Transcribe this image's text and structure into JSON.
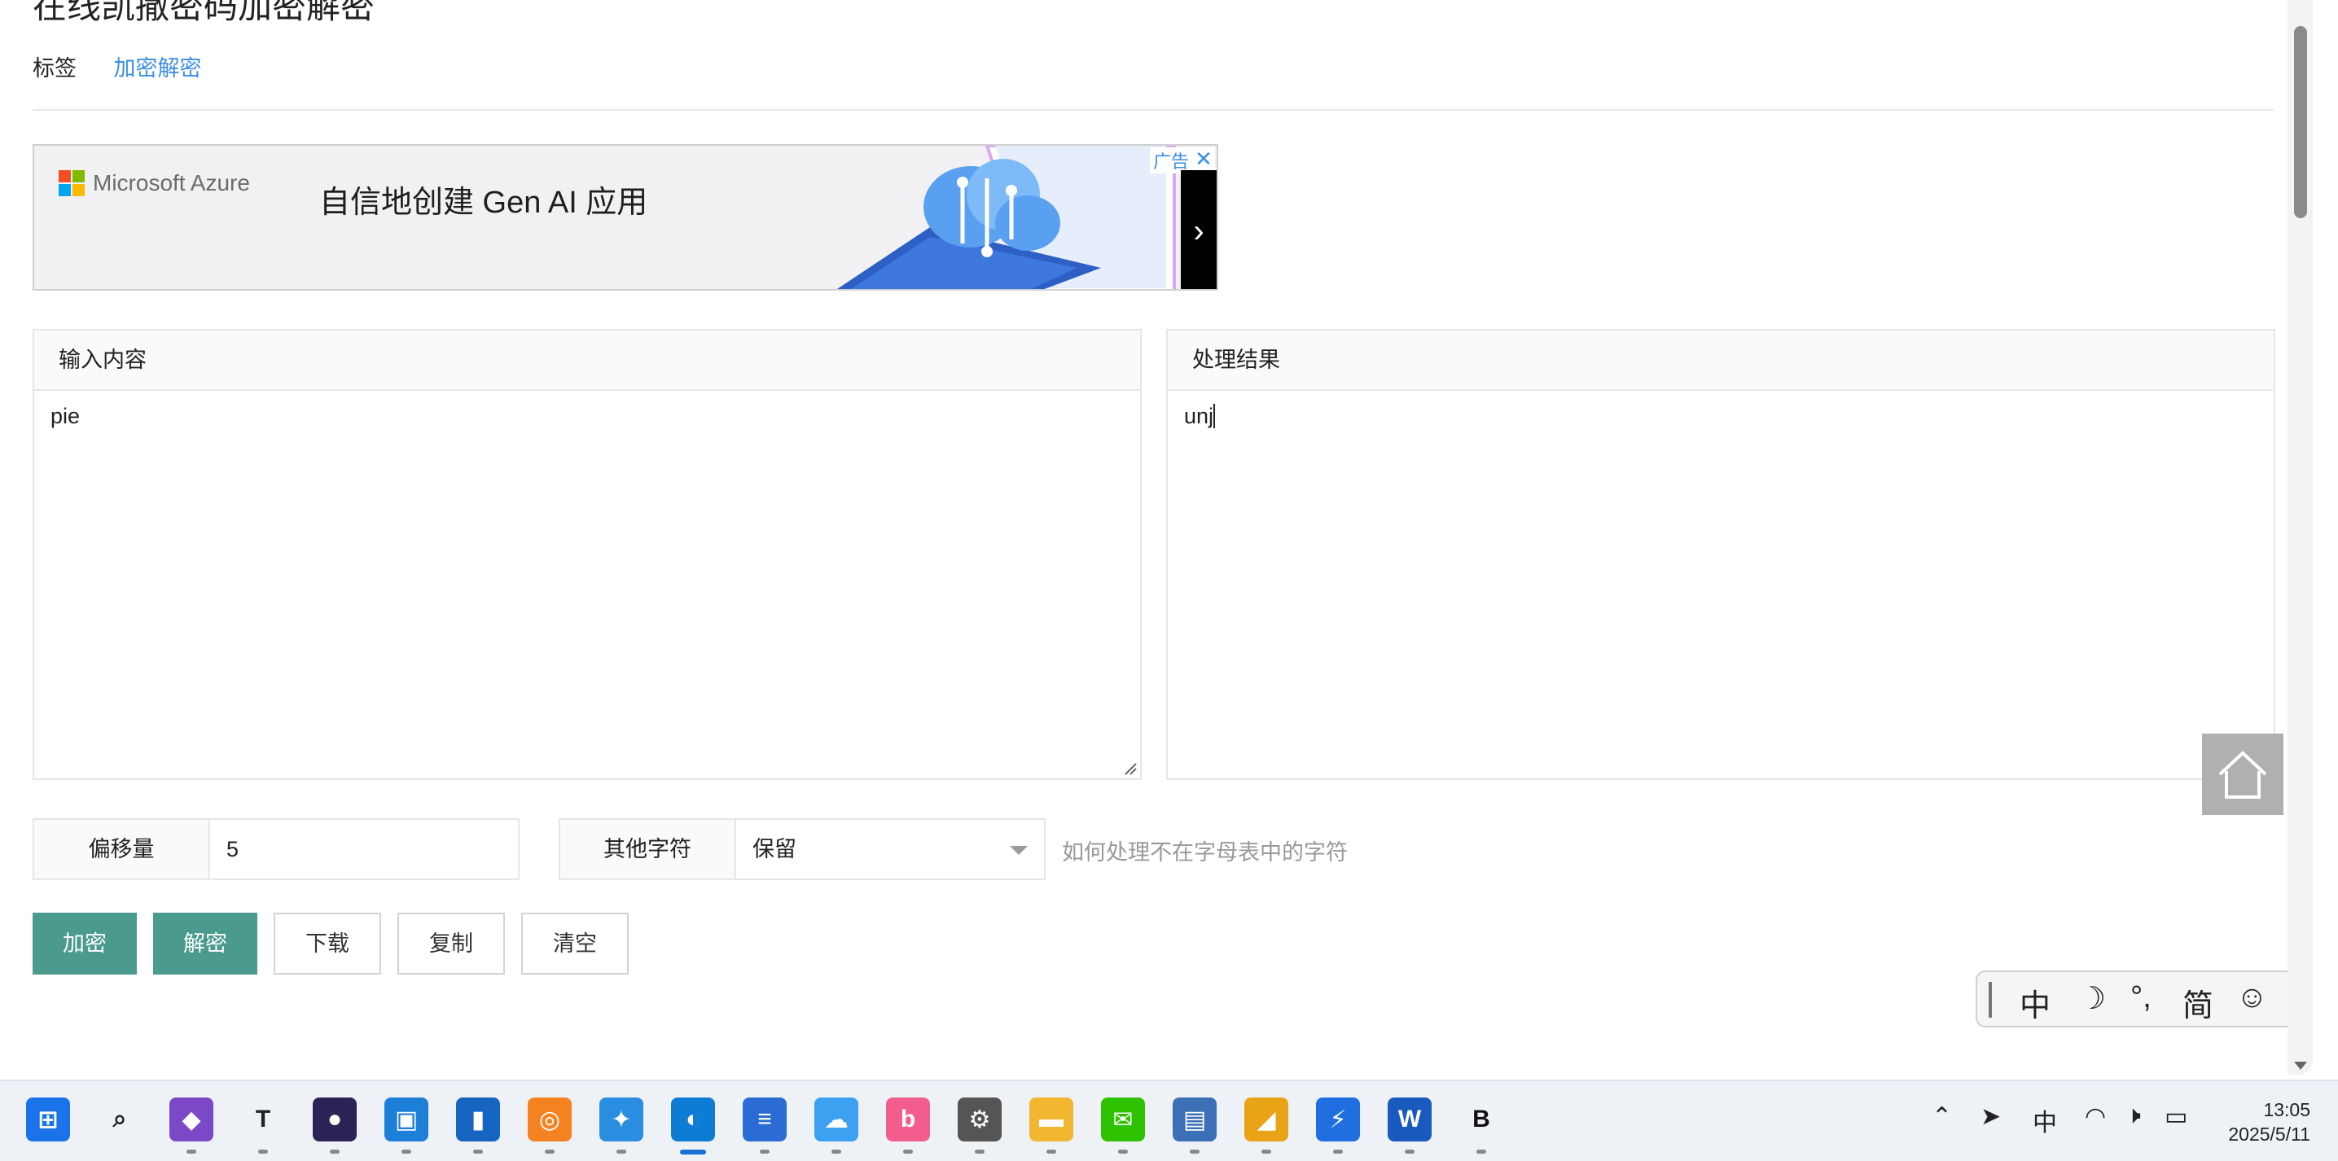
{
  "page": {
    "title": "在线凯撒密码加密解密",
    "tag_label": "标签",
    "tag_link": "加密解密"
  },
  "ad": {
    "brand": "Microsoft Azure",
    "headline": "自信地创建 Gen AI 应用",
    "label": "广告",
    "close": "✕",
    "next": "›",
    "colors": {
      "ms_red": "#f25022",
      "ms_green": "#7fba00",
      "ms_blue": "#00a4ef",
      "ms_yellow": "#ffb900"
    }
  },
  "input_panel": {
    "header": "输入内容",
    "value": "pie"
  },
  "output_panel": {
    "header": "处理结果",
    "value": "unj"
  },
  "controls": {
    "offset_label": "偏移量",
    "offset_value": "5",
    "other_label": "其他字符",
    "other_value": "保留",
    "hint": "如何处理不在字母表中的字符"
  },
  "buttons": {
    "encrypt": "加密",
    "decrypt": "解密",
    "download": "下载",
    "copy": "复制",
    "clear": "清空"
  },
  "ime_toolbar": {
    "lang": "中",
    "moon": "☽",
    "punct": "°,",
    "simplified": "简",
    "emoji": "☺",
    "settings": "⚙"
  },
  "taskbar": {
    "apps": [
      {
        "name": "start-icon",
        "glyph": "⊞",
        "color": "#1a73e8"
      },
      {
        "name": "search-icon",
        "glyph": "⌕",
        "color": "#222222"
      },
      {
        "name": "visual-studio-icon",
        "glyph": "◆",
        "color": "#7b49c8"
      },
      {
        "name": "typora-icon",
        "glyph": "T",
        "color": "#222222"
      },
      {
        "name": "eclipse-icon",
        "glyph": "●",
        "color": "#2c2255"
      },
      {
        "name": "virtualbox-icon",
        "glyph": "▣",
        "color": "#1e7fd8"
      },
      {
        "name": "winrar-icon",
        "glyph": "▮",
        "color": "#1565c0"
      },
      {
        "name": "everything-search-icon",
        "glyph": "◎",
        "color": "#f58220"
      },
      {
        "name": "chat-app-icon",
        "glyph": "✦",
        "color": "#2a8de0"
      },
      {
        "name": "edge-browser-icon",
        "glyph": "◐",
        "color": "#0c7cd5"
      },
      {
        "name": "notepad-icon",
        "glyph": "≡",
        "color": "#2b6cd4"
      },
      {
        "name": "baidu-netdisk-icon",
        "glyph": "☁",
        "color": "#3da0f0"
      },
      {
        "name": "bilibili-icon",
        "glyph": "b",
        "color": "#f25d8e"
      },
      {
        "name": "settings-icon",
        "glyph": "⚙",
        "color": "#555555"
      },
      {
        "name": "file-explorer-icon",
        "glyph": "▬",
        "color": "#f2b630"
      },
      {
        "name": "wechat-icon",
        "glyph": "✉",
        "color": "#2dc100"
      },
      {
        "name": "window-manager-icon",
        "glyph": "▤",
        "color": "#3b6fb6"
      },
      {
        "name": "mail-app-icon",
        "glyph": "◢",
        "color": "#e8a317"
      },
      {
        "name": "thunder-download-icon",
        "glyph": "⚡",
        "color": "#1f6fe0"
      },
      {
        "name": "word-icon",
        "glyph": "W",
        "color": "#185abd"
      },
      {
        "name": "bd-app-icon",
        "glyph": "B",
        "color": "#111111"
      }
    ],
    "tray": {
      "lang": "中",
      "time": "13:05",
      "date": "2025/5/11"
    }
  }
}
